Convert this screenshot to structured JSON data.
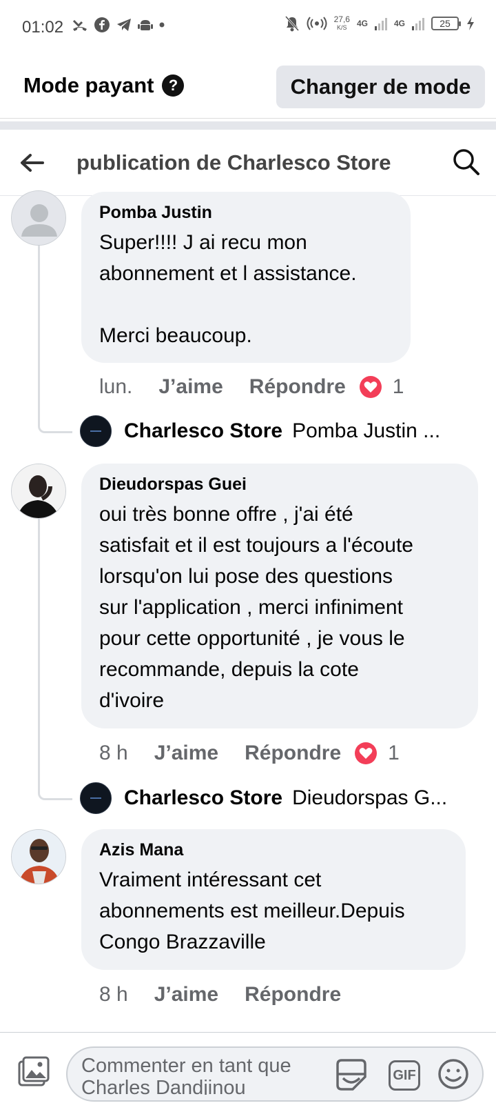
{
  "status_bar": {
    "time": "01:02",
    "speed_value": "27,6",
    "speed_unit": "K/S",
    "net1": "4G",
    "net2": "4G",
    "battery": "25"
  },
  "mode_bar": {
    "title": "Mode payant",
    "help_glyph": "?",
    "button_label": "Changer de mode"
  },
  "header": {
    "title": "publication de Charlesco Store"
  },
  "comments": [
    {
      "author": "Pomba Justin",
      "text": "Super!!!! J ai recu mon\nabonnement et l assistance.\n\nMerci beaucoup.",
      "time": "lun.",
      "like_label": "J’aime",
      "reply_label": "Répondre",
      "reaction_count": "1",
      "reply": {
        "author": "Charlesco Store",
        "snippet": "Pomba Justin ..."
      }
    },
    {
      "author": "Dieudorspas Guei",
      "text": "oui très bonne offre , j'ai été\nsatisfait et il est toujours a l'écoute\nlorsqu'on lui pose des questions\nsur l'application , merci infiniment\npour cette opportunité , je vous le\nrecommande, depuis la cote\nd'ivoire",
      "time": "8 h",
      "like_label": "J’aime",
      "reply_label": "Répondre",
      "reaction_count": "1",
      "reply": {
        "author": "Charlesco Store",
        "snippet": "Dieudorspas G..."
      }
    },
    {
      "author": "Azis Mana",
      "text": "Vraiment intéressant cet\nabonnements est meilleur.Depuis\nCongo Brazzaville",
      "time": "8 h",
      "like_label": "J’aime",
      "reply_label": "Répondre"
    }
  ],
  "composer": {
    "placeholder": "Commenter en tant que Charles Dandjinou",
    "gif_label": "GIF"
  },
  "colors": {
    "bubble": "#f0f2f5",
    "heart": "#f33e58",
    "meta_text": "#65676b"
  }
}
